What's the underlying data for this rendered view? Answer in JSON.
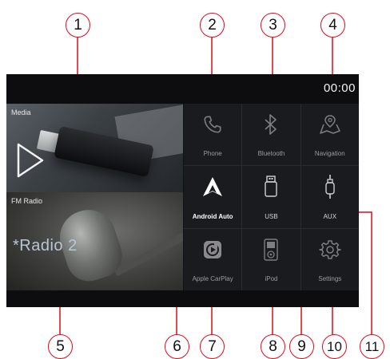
{
  "screen": {
    "clock": "00:00",
    "media": {
      "label": "Media"
    },
    "fm": {
      "label": "FM Radio",
      "station": "*Radio 2"
    },
    "apps": [
      {
        "id": "phone",
        "label": "Phone",
        "icon": "phone-icon"
      },
      {
        "id": "bluetooth",
        "label": "Bluetooth",
        "icon": "bluetooth-icon"
      },
      {
        "id": "navigation",
        "label": "Navigation",
        "icon": "map-pin-icon"
      },
      {
        "id": "android-auto",
        "label": "Android Auto",
        "icon": "android-auto-icon"
      },
      {
        "id": "usb",
        "label": "USB",
        "icon": "usb-drive-icon"
      },
      {
        "id": "aux",
        "label": "AUX",
        "icon": "aux-plug-icon"
      },
      {
        "id": "apple-carplay",
        "label": "Apple CarPlay",
        "icon": "carplay-icon"
      },
      {
        "id": "ipod",
        "label": "iPod",
        "icon": "ipod-icon"
      },
      {
        "id": "settings",
        "label": "Settings",
        "icon": "gear-icon"
      }
    ]
  },
  "callouts": [
    "1",
    "2",
    "3",
    "4",
    "5",
    "6",
    "7",
    "8",
    "9",
    "10",
    "11"
  ],
  "colors": {
    "callout": "#e10a1b",
    "screen": "#111214",
    "accent_white": "#ffffff"
  }
}
